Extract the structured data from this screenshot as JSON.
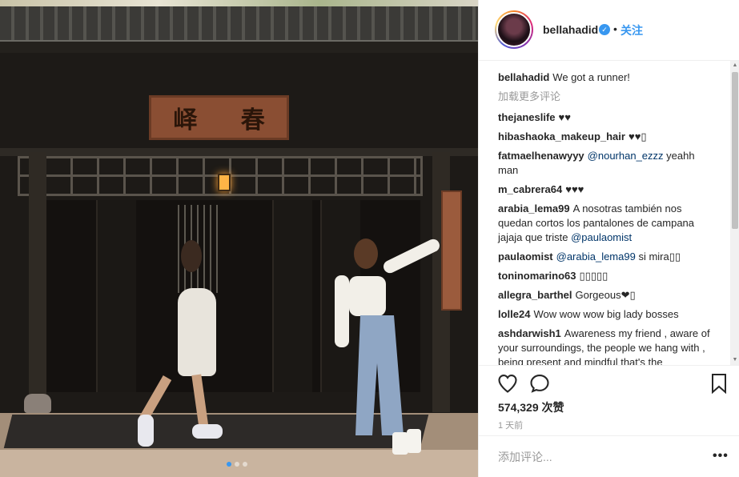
{
  "post": {
    "author": "bellahadid",
    "verified_icon": "verified-badge-icon",
    "separator": "•",
    "follow_label": "关注",
    "photo": {
      "plaque_chars": [
        "峄",
        "春"
      ],
      "carousel_dots": 3,
      "active_dot": 0
    }
  },
  "comments_section": {
    "caption": {
      "user": "bellahadid",
      "text": "We got a runner!"
    },
    "load_more_label": "加载更多评论",
    "comments": [
      {
        "user": "thejaneslife",
        "text": "♥♥"
      },
      {
        "user": "hibashaoka_makeup_hair",
        "text": "♥♥▯"
      },
      {
        "user": "fatmaelhenawyyy",
        "mention": "@nourhan_ezzz",
        "text": " yeahh man"
      },
      {
        "user": "m_cabrera64",
        "text": "♥♥♥"
      },
      {
        "user": "arabia_lema99",
        "text": "A nosotras también nos quedan cortos los pantalones de campana jajaja que triste ",
        "mention_after": "@paulaomist"
      },
      {
        "user": "paulaomist",
        "mention": "@arabia_lema99",
        "text": " si mira▯▯"
      },
      {
        "user": "toninomarino63",
        "text": "▯▯▯▯▯"
      },
      {
        "user": "allegra_barthel",
        "text": "Gorgeous❤▯"
      },
      {
        "user": "lolle24",
        "text": "Wow wow wow big lady bosses"
      },
      {
        "user": "ashdarwish1",
        "text": "Awareness my friend , aware of your surroundings, the people we hang with , being present and mindful that's the"
      }
    ]
  },
  "actions": {
    "like_icon": "heart-icon",
    "comment_icon": "comment-bubble-icon",
    "save_icon": "bookmark-icon",
    "likes_count": "574,329",
    "likes_suffix": "次赞",
    "timestamp": "1 天前"
  },
  "add_comment": {
    "placeholder": "添加评论...",
    "more_label": "•••"
  },
  "colors": {
    "accent": "#3897f0",
    "text": "#262626",
    "muted": "#999999",
    "divider": "#efefef"
  }
}
